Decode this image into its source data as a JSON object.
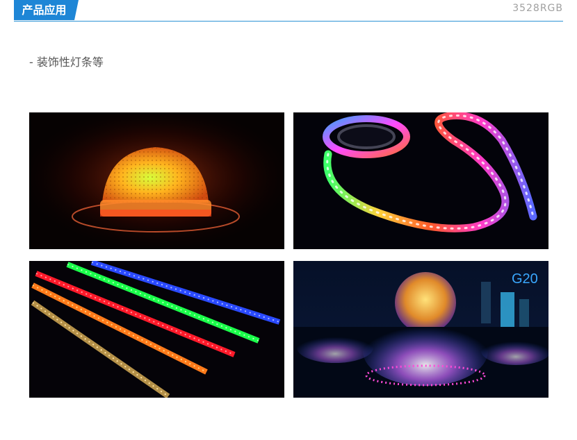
{
  "header": {
    "section_label": "产品应用",
    "model": "3528RGB",
    "accent_color": "#1e86d6"
  },
  "description": "- 装饰性灯条等",
  "photos": [
    {
      "subject": "orange dome pixel light"
    },
    {
      "subject": "rainbow LED strip reel"
    },
    {
      "subject": "colored LED light bars"
    },
    {
      "subject": "illuminated fountain at night",
      "badge": "G20"
    }
  ]
}
